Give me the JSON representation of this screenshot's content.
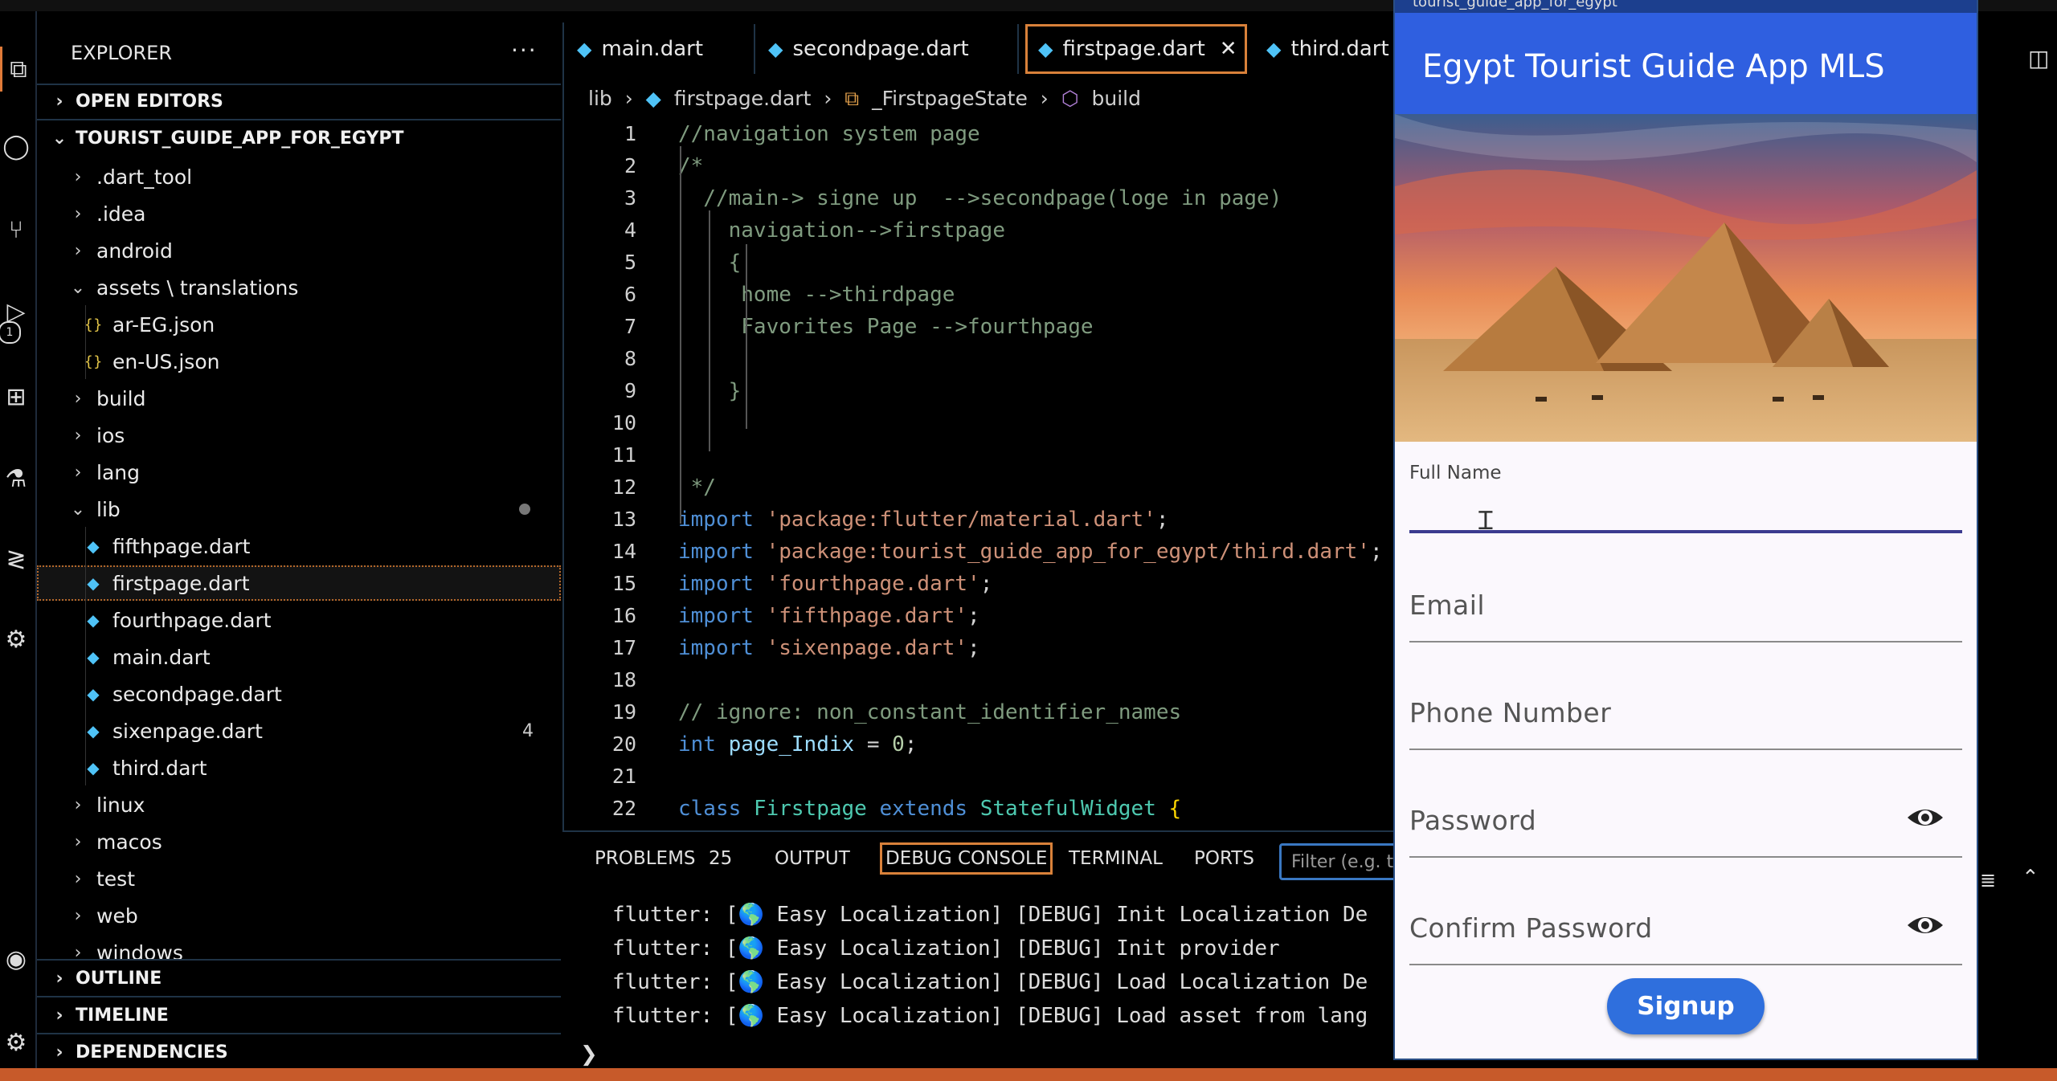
{
  "explorer": {
    "header": "EXPLORER",
    "more": "···",
    "open_editors": "OPEN EDITORS",
    "project": "TOURIST_GUIDE_APP_FOR_EGYPT",
    "tree": [
      {
        "label": ".dart_tool",
        "kind": "folder"
      },
      {
        "label": ".idea",
        "kind": "folder"
      },
      {
        "label": "android",
        "kind": "folder"
      },
      {
        "label": "assets \\ translations",
        "kind": "folder-open"
      },
      {
        "label": "ar-EG.json",
        "kind": "json"
      },
      {
        "label": "en-US.json",
        "kind": "json"
      },
      {
        "label": "build",
        "kind": "folder"
      },
      {
        "label": "ios",
        "kind": "folder"
      },
      {
        "label": "lang",
        "kind": "folder"
      },
      {
        "label": "lib",
        "kind": "folder-open"
      },
      {
        "label": "fifthpage.dart",
        "kind": "dart"
      },
      {
        "label": "firstpage.dart",
        "kind": "dart"
      },
      {
        "label": "fourthpage.dart",
        "kind": "dart"
      },
      {
        "label": "main.dart",
        "kind": "dart"
      },
      {
        "label": "secondpage.dart",
        "kind": "dart"
      },
      {
        "label": "sixenpage.dart",
        "kind": "dart",
        "badge": "4"
      },
      {
        "label": "third.dart",
        "kind": "dart"
      },
      {
        "label": "linux",
        "kind": "folder"
      },
      {
        "label": "macos",
        "kind": "folder"
      },
      {
        "label": "test",
        "kind": "folder"
      },
      {
        "label": "web",
        "kind": "folder"
      },
      {
        "label": "windows",
        "kind": "folder"
      }
    ],
    "outline": "OUTLINE",
    "timeline": "TIMELINE",
    "dependencies": "DEPENDENCIES"
  },
  "tabs": [
    {
      "label": "main.dart"
    },
    {
      "label": "secondpage.dart"
    },
    {
      "label": "firstpage.dart",
      "close": "✕"
    },
    {
      "label": "third.dart"
    }
  ],
  "breadcrumb": {
    "folder": "lib",
    "file": "firstpage.dart",
    "class": "_FirstpageState",
    "method": "build"
  },
  "code_lines": [
    "//navigation system page",
    "/*",
    "  //main-> signe up  -->secondpage(loge in page)",
    "    navigation-->firstpage",
    "    {",
    "     home -->thirdpage",
    "     Favorites Page -->fourthpage",
    "",
    "    }",
    "",
    "",
    " */",
    "import 'package:flutter/material.dart';",
    "import 'package:tourist_guide_app_for_egypt/third.dart';",
    "import 'fourthpage.dart';",
    "import 'fifthpage.dart';",
    "import 'sixenpage.dart';",
    "",
    "// ignore: non_constant_identifier_names",
    "int page_Indix = 0;",
    "",
    "class Firstpage extends StatefulWidget {"
  ],
  "panel": {
    "tabs": [
      "PROBLEMS",
      "OUTPUT",
      "DEBUG CONSOLE",
      "TERMINAL",
      "PORTS"
    ],
    "problems_count": "25",
    "filter_placeholder": "Filter (e.g. text",
    "prompt": "❯",
    "logs": [
      "flutter: [🌎 Easy Localization] [DEBUG] Init Localization De",
      "flutter: [🌎 Easy Localization] [DEBUG] Init provider",
      "flutter: [🌎 Easy Localization] [DEBUG] Load Localization De",
      "flutter: [🌎 Easy Localization] [DEBUG] Load asset from lang"
    ]
  },
  "app": {
    "window_title": "tourist_guide_app_for_egypt",
    "title": "Egypt Tourist Guide App MLS",
    "fields": {
      "full_name_label": "Full Name",
      "email": "Email",
      "phone": "Phone Number",
      "password": "Password",
      "confirm_password": "Confirm Password"
    },
    "signup": "Signup"
  },
  "colors": {
    "accent_orange": "#d9813a",
    "app_bar": "#2f5fe0",
    "signup_button": "#2f6fdd",
    "status_bar": "#c75a2a"
  }
}
